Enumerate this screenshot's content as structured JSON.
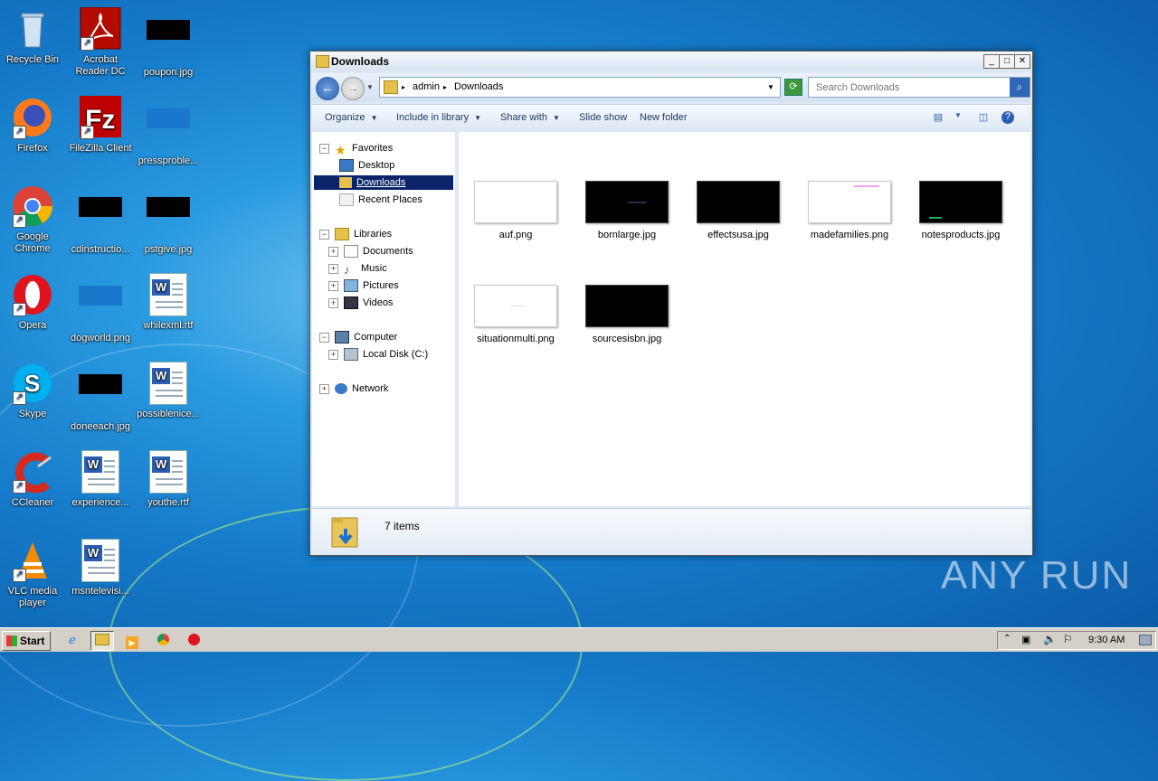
{
  "desktop": {
    "icons": [
      {
        "label": "Recycle Bin"
      },
      {
        "label": "Acrobat Reader DC"
      },
      {
        "label": "poupon.jpg"
      },
      {
        "label": "Firefox"
      },
      {
        "label": "FileZilla Client"
      },
      {
        "label": "pressproble..."
      },
      {
        "label": "Google Chrome"
      },
      {
        "label": "cdinstructio..."
      },
      {
        "label": "pstgive.jpg"
      },
      {
        "label": "Opera"
      },
      {
        "label": "dogworld.png"
      },
      {
        "label": "whilexml.rtf"
      },
      {
        "label": "Skype"
      },
      {
        "label": "doneeach.jpg"
      },
      {
        "label": "possiblenice..."
      },
      {
        "label": "CCleaner"
      },
      {
        "label": "experience..."
      },
      {
        "label": "youthe.rtf"
      },
      {
        "label": "VLC media player"
      },
      {
        "label": "msntelevisi..."
      }
    ]
  },
  "window": {
    "title": "Downloads",
    "controls": {
      "minimize": "_",
      "maximize": "□",
      "close": "✕"
    },
    "address": {
      "crumbs": [
        "admin",
        "Downloads"
      ]
    },
    "search": {
      "placeholder": "Search Downloads"
    },
    "toolbar": {
      "organize": "Organize",
      "include_in_library": "Include in library",
      "share_with": "Share with",
      "slide_show": "Slide show",
      "new_folder": "New folder"
    },
    "nav": {
      "favorites": "Favorites",
      "desktop": "Desktop",
      "downloads": "Downloads",
      "recent_places": "Recent Places",
      "libraries": "Libraries",
      "documents": "Documents",
      "music": "Music",
      "pictures": "Pictures",
      "videos": "Videos",
      "computer": "Computer",
      "local_disk": "Local Disk (C:)",
      "network": "Network"
    },
    "files": [
      {
        "name": "auf.png",
        "thumb": "white"
      },
      {
        "name": "bornlarge.jpg",
        "thumb": "black"
      },
      {
        "name": "effectsusa.jpg",
        "thumb": "black"
      },
      {
        "name": "madefamilies.png",
        "thumb": "white"
      },
      {
        "name": "notesproducts.jpg",
        "thumb": "black"
      },
      {
        "name": "situationmulti.png",
        "thumb": "white"
      },
      {
        "name": "sourcesisbn.jpg",
        "thumb": "black"
      }
    ],
    "status": {
      "item_count": "7 items"
    }
  },
  "taskbar": {
    "start_label": "Start",
    "clock": "9:30 AM"
  },
  "watermark": "ANY RUN"
}
